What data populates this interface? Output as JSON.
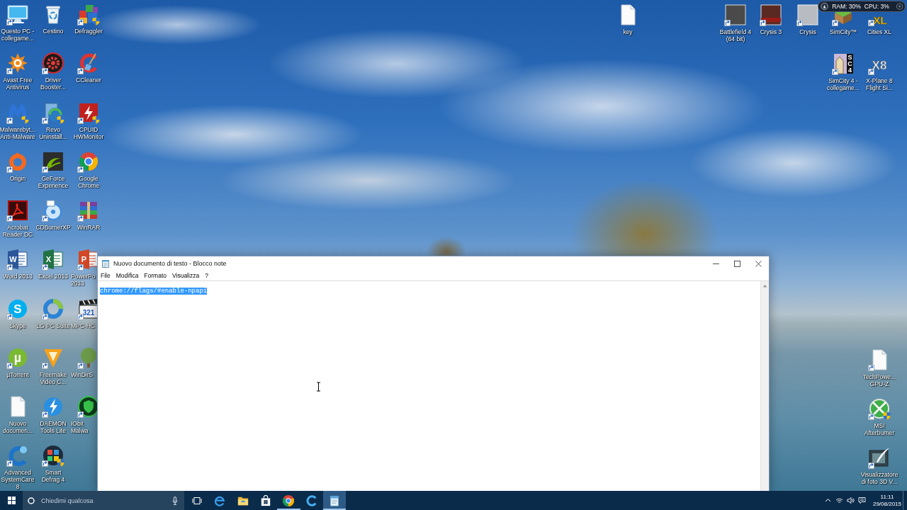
{
  "desktop": {
    "left_icons": [
      [
        {
          "label": "Questo PC - collegame...",
          "kind": "computer",
          "shortcut": true,
          "shield": false
        },
        {
          "label": "Avast Free Antivirus",
          "kind": "splat",
          "shortcut": true,
          "shield": false
        },
        {
          "label": "Malwarebyt... Anti-Malware",
          "kind": "wing",
          "shortcut": true,
          "shield": true
        },
        {
          "label": "Origin",
          "kind": "ring",
          "shortcut": true,
          "shield": false
        },
        {
          "label": "Acrobat Reader DC",
          "kind": "acrobat",
          "shortcut": true,
          "shield": false
        },
        {
          "label": "Word 2013",
          "kind": "wordtile",
          "glyph": "W",
          "shortcut": true,
          "shield": false
        },
        {
          "label": "Skype",
          "kind": "bubble",
          "glyph": "S",
          "shortcut": true,
          "shield": false
        },
        {
          "label": "µTorrent",
          "kind": "torrent",
          "glyph": "µ",
          "shortcut": true,
          "shield": false
        },
        {
          "label": "Nuovo documen...",
          "kind": "document",
          "shortcut": false,
          "shield": false
        },
        {
          "label": "Advanced SystemCare 8",
          "kind": "carering",
          "shortcut": true,
          "shield": false
        }
      ],
      [
        {
          "label": "Cestino",
          "kind": "bin",
          "shortcut": false,
          "shield": false
        },
        {
          "label": "Driver Booster...",
          "kind": "gearbadge",
          "shortcut": true,
          "shield": false
        },
        {
          "label": "Revo Uninstall...",
          "kind": "revo",
          "shortcut": true,
          "shield": true
        },
        {
          "label": "GeForce Experience",
          "kind": "swirltile",
          "shortcut": true,
          "shield": false
        },
        {
          "label": "CDBurnerXP",
          "kind": "disc",
          "shortcut": true,
          "shield": false
        },
        {
          "label": "Excel 2013",
          "kind": "sheettile",
          "glyph": "X",
          "shortcut": true,
          "shield": false
        },
        {
          "label": "LG PC Suite",
          "kind": "swirl",
          "shortcut": true,
          "shield": false
        },
        {
          "label": "Freemake Video C...",
          "kind": "chevron",
          "shortcut": true,
          "shield": false
        },
        {
          "label": "DAEMON Tools Lite",
          "kind": "bolt",
          "shortcut": true,
          "shield": false
        },
        {
          "label": "Smart Defrag 4",
          "kind": "blocks",
          "shortcut": true,
          "shield": true
        }
      ],
      [
        {
          "label": "Defraggler",
          "kind": "cubes",
          "shortcut": true,
          "shield": true
        },
        {
          "label": "CCleaner",
          "kind": "broom",
          "shortcut": true,
          "shield": false
        },
        {
          "label": "CPUID HWMonitor",
          "kind": "bolttile",
          "shortcut": true,
          "shield": true
        },
        {
          "label": "Google Chrome",
          "kind": "chrome",
          "shortcut": true,
          "shield": false
        },
        {
          "label": "WinRAR",
          "kind": "books",
          "shortcut": true,
          "shield": false
        },
        {
          "label": "PowerPo 2013",
          "kind": "slidetile",
          "glyph": "P",
          "shortcut": true,
          "shield": false
        },
        {
          "label": "MPC-HC",
          "kind": "clapper",
          "glyph": "321",
          "shortcut": true,
          "shield": false
        },
        {
          "label": "WinDirS",
          "kind": "tree",
          "shortcut": true,
          "shield": false
        },
        {
          "label": "IObit Malwa",
          "kind": "shieldbadge",
          "shortcut": true,
          "shield": false
        }
      ]
    ],
    "right_icons": [
      {
        "label": "key",
        "kind": "document",
        "shortcut": false,
        "shield": false
      },
      {
        "label": "Battlefield 4 (64 bit)",
        "kind": "darkcover",
        "shortcut": true,
        "shield": false
      },
      {
        "label": "Crysis 3",
        "kind": "redcover",
        "shortcut": true,
        "shield": false
      },
      {
        "label": "Crysis",
        "kind": "greycover",
        "shortcut": true,
        "shield": false
      },
      {
        "label": "SimCity™",
        "kind": "terrain",
        "shortcut": true,
        "shield": false
      },
      {
        "label": "Cities XL",
        "kind": "xl",
        "glyph": "XL",
        "shortcut": true,
        "shield": false
      },
      {
        "label": "SimCity 4 - collegame...",
        "kind": "sc4",
        "glyph": "SC4",
        "shortcut": true,
        "shield": false
      },
      {
        "label": "X-Plane 8 Flight Si...",
        "kind": "xplane",
        "glyph": "X8",
        "shortcut": true,
        "shield": false
      },
      {
        "label": "TechPowe... GPU-Z",
        "kind": "document",
        "shortcut": true,
        "shield": false
      },
      {
        "label": "MSI Afterburner",
        "kind": "msi",
        "shortcut": true,
        "shield": true
      },
      {
        "label": "Visualizzatore di foto 3D V...",
        "kind": "frame",
        "shortcut": true,
        "shield": false
      }
    ]
  },
  "system_monitor": {
    "ram": "RAM: 30%",
    "cpu": "CPU: 3%"
  },
  "notepad": {
    "title": "Nuovo documento di testo - Blocco note",
    "menu": [
      "File",
      "Modifica",
      "Formato",
      "Visualizza",
      "?"
    ],
    "text": "chrome://flags/#enable-npapi",
    "selected": true
  },
  "taskbar": {
    "search": {
      "placeholder": "Chiedimi qualcosa"
    },
    "apps": [
      {
        "kind": "edge",
        "running": false,
        "selected": false
      },
      {
        "kind": "folder",
        "running": false,
        "selected": false
      },
      {
        "kind": "store",
        "running": false,
        "selected": false
      },
      {
        "kind": "chrome",
        "running": true,
        "selected": false
      },
      {
        "kind": "cring",
        "running": false,
        "selected": false
      },
      {
        "kind": "notepad",
        "running": true,
        "selected": true
      }
    ],
    "clock": {
      "time": "11:11",
      "date": "29/08/2015"
    }
  }
}
